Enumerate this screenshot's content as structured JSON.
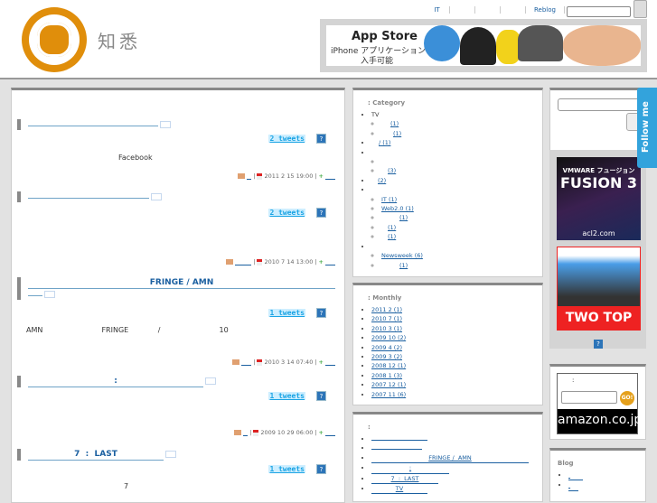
{
  "site": {
    "title": "知悉"
  },
  "topnav": [
    "IT",
    "",
    "",
    "",
    "Reblog"
  ],
  "banner": {
    "line1": "App Store",
    "line2": "iPhone アプリケーション",
    "line3": "入手可能"
  },
  "posts": [
    {
      "title": "",
      "tweets": "2 tweets",
      "body": "Facebook",
      "date": "2011 2 15  19:00"
    },
    {
      "title": "",
      "tweets": "2 tweets",
      "body": "",
      "date": "2010 7 14  13:00"
    },
    {
      "title": "FRINGE /  AMN",
      "tweets": "1 tweets",
      "body": "AMN  FRINGE /  10",
      "date": "2010 3 14  07:40"
    },
    {
      "title": ":",
      "tweets": "1 tweets",
      "body": "",
      "date": "2009 10 29  06:00"
    },
    {
      "title": "7  :  LAST",
      "tweets": "1 tweets",
      "body": "7",
      "date": ""
    }
  ],
  "category": {
    "title": ": Category",
    "items": [
      {
        "label": "TV",
        "children": [
          "(1)",
          "(1)"
        ]
      },
      {
        "label": "/ (1)",
        "link": true
      },
      {
        "label": "",
        "children": [
          "",
          "(3)"
        ]
      },
      {
        "label": "(2)",
        "link": true
      },
      {
        "label": "",
        "children": [
          "IT (1)",
          "Web2.0 (1)",
          "(1)",
          "(1)",
          "(1)"
        ]
      },
      {
        "label": "",
        "children": [
          "Newsweek (6)",
          "(1)"
        ]
      }
    ]
  },
  "monthly": {
    "title": ": Monthly",
    "items": [
      "2011 2 (1)",
      "2010 7 (1)",
      "2010 3 (1)",
      "2009 10 (2)",
      "2009 4 (2)",
      "2009 3 (2)",
      "2008 12 (1)",
      "2008 1 (3)",
      "2007 12 (1)",
      "2007 11 (6)"
    ]
  },
  "recent": {
    "title": ":",
    "items": [
      "",
      "",
      "FRINGE /  AMN",
      ":",
      "7  :  LAST",
      "TV"
    ]
  },
  "ads": {
    "vmware_1": "VMWARE フュージョン",
    "vmware_2": "FUSION 3",
    "vmware_3": "acl2.com",
    "twotop": "TWO TOP"
  },
  "amazon": {
    "label": ":",
    "go": "GO!",
    "logo": "amazon.co.jp"
  },
  "blog": {
    "title": "Blog"
  },
  "follow": "Follow me",
  "colors": {
    "accent": "#1a5fa0",
    "logo": "#e08e0b",
    "twitter": "#33a3dc"
  }
}
